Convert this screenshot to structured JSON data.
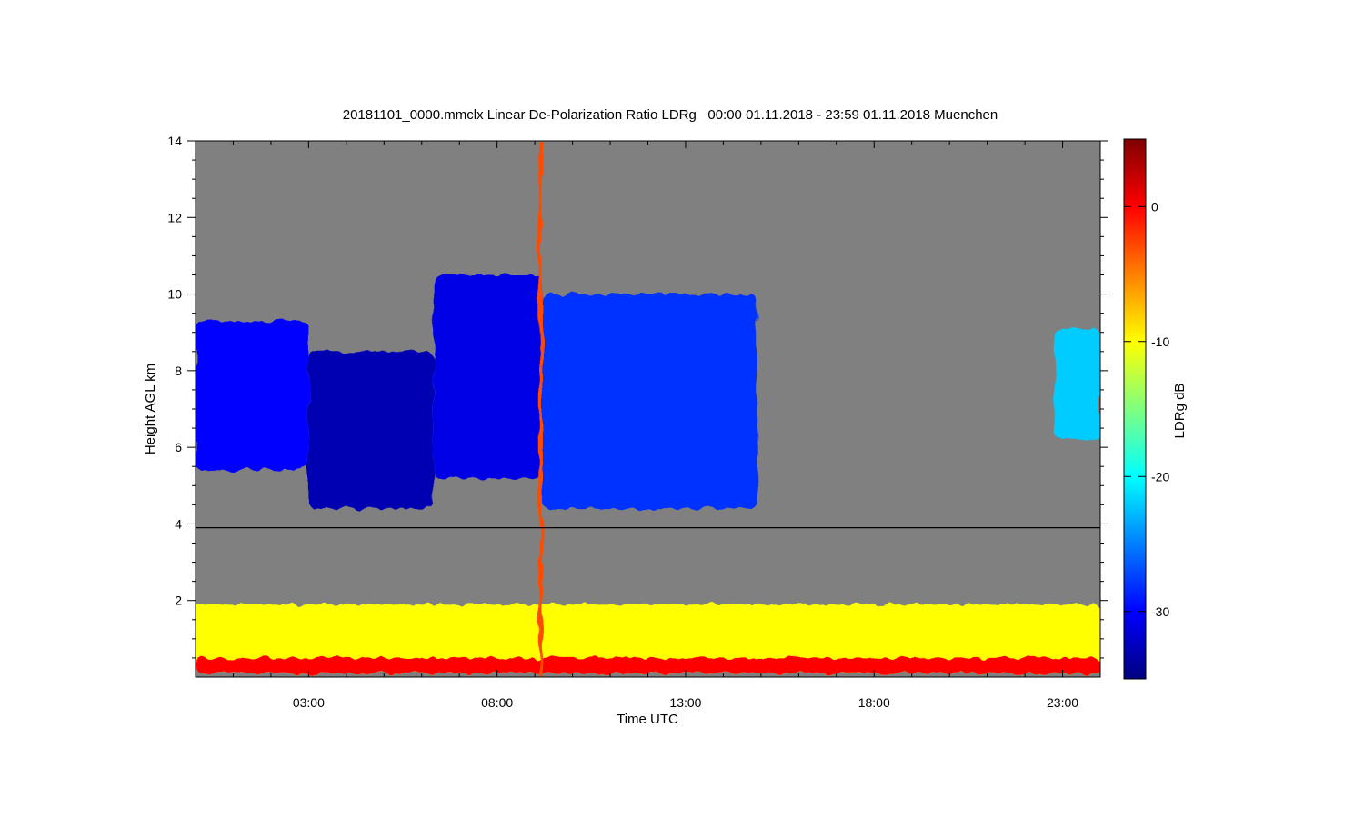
{
  "chart_data": {
    "type": "heatmap",
    "title": "20181101_0000.mmclx Linear De-Polarization Ratio LDRg   00:00 01.11.2018 - 23:59 01.11.2018 Muenchen",
    "xlabel": "Time UTC",
    "ylabel": "Height AGL km",
    "x_ticks": [
      "03:00",
      "08:00",
      "13:00",
      "18:00",
      "23:00"
    ],
    "x_tick_hours": [
      3,
      8,
      13,
      18,
      23
    ],
    "xlim_hours": [
      0,
      24
    ],
    "y_ticks": [
      "2",
      "4",
      "6",
      "8",
      "10",
      "12",
      "14"
    ],
    "y_tick_values": [
      2,
      4,
      6,
      8,
      10,
      12,
      14
    ],
    "ylim_km": [
      0,
      14
    ],
    "background_color": "#808080",
    "colorbar": {
      "label": "LDRg dB",
      "ticks": [
        "0",
        "-10",
        "-20",
        "-30"
      ],
      "tick_values": [
        0,
        -10,
        -20,
        -30
      ],
      "range_db": [
        -35,
        5
      ],
      "colormap": "jet"
    },
    "reference_line": {
      "height_km": 3.9,
      "color": "#000000"
    },
    "features": [
      {
        "name": "ice cloud 00-03h",
        "t_start": 0,
        "t_end": 3.0,
        "bottom_km": 5.4,
        "top_km": 9.3,
        "ldr_db": -30
      },
      {
        "name": "ice cloud 03-06h",
        "t_start": 3.0,
        "t_end": 6.3,
        "bottom_km": 4.4,
        "top_km": 8.5,
        "ldr_db": -33
      },
      {
        "name": "ice cloud 06-09h",
        "t_start": 6.3,
        "t_end": 9.2,
        "bottom_km": 5.2,
        "top_km": 10.5,
        "ldr_db": -31
      },
      {
        "name": "ice cloud 09-15h",
        "t_start": 9.2,
        "t_end": 14.9,
        "bottom_km": 4.4,
        "top_km": 10.0,
        "ldr_db": -28
      },
      {
        "name": "ice cloud 23h",
        "t_start": 22.8,
        "t_end": 24.0,
        "bottom_km": 6.2,
        "top_km": 9.1,
        "ldr_db": -22
      },
      {
        "name": "boundary layer clutter",
        "t_start": 0,
        "t_end": 24.0,
        "bottom_km": 0.1,
        "top_km": 1.9,
        "ldr_db": -10
      },
      {
        "name": "near-surface clutter",
        "t_start": 0,
        "t_end": 24.0,
        "bottom_km": 0.1,
        "top_km": 0.5,
        "ldr_db": 0
      },
      {
        "name": "vertical artifact",
        "t_start": 9.1,
        "t_end": 9.2,
        "bottom_km": 0,
        "top_km": 14,
        "ldr_db": -3
      }
    ]
  }
}
